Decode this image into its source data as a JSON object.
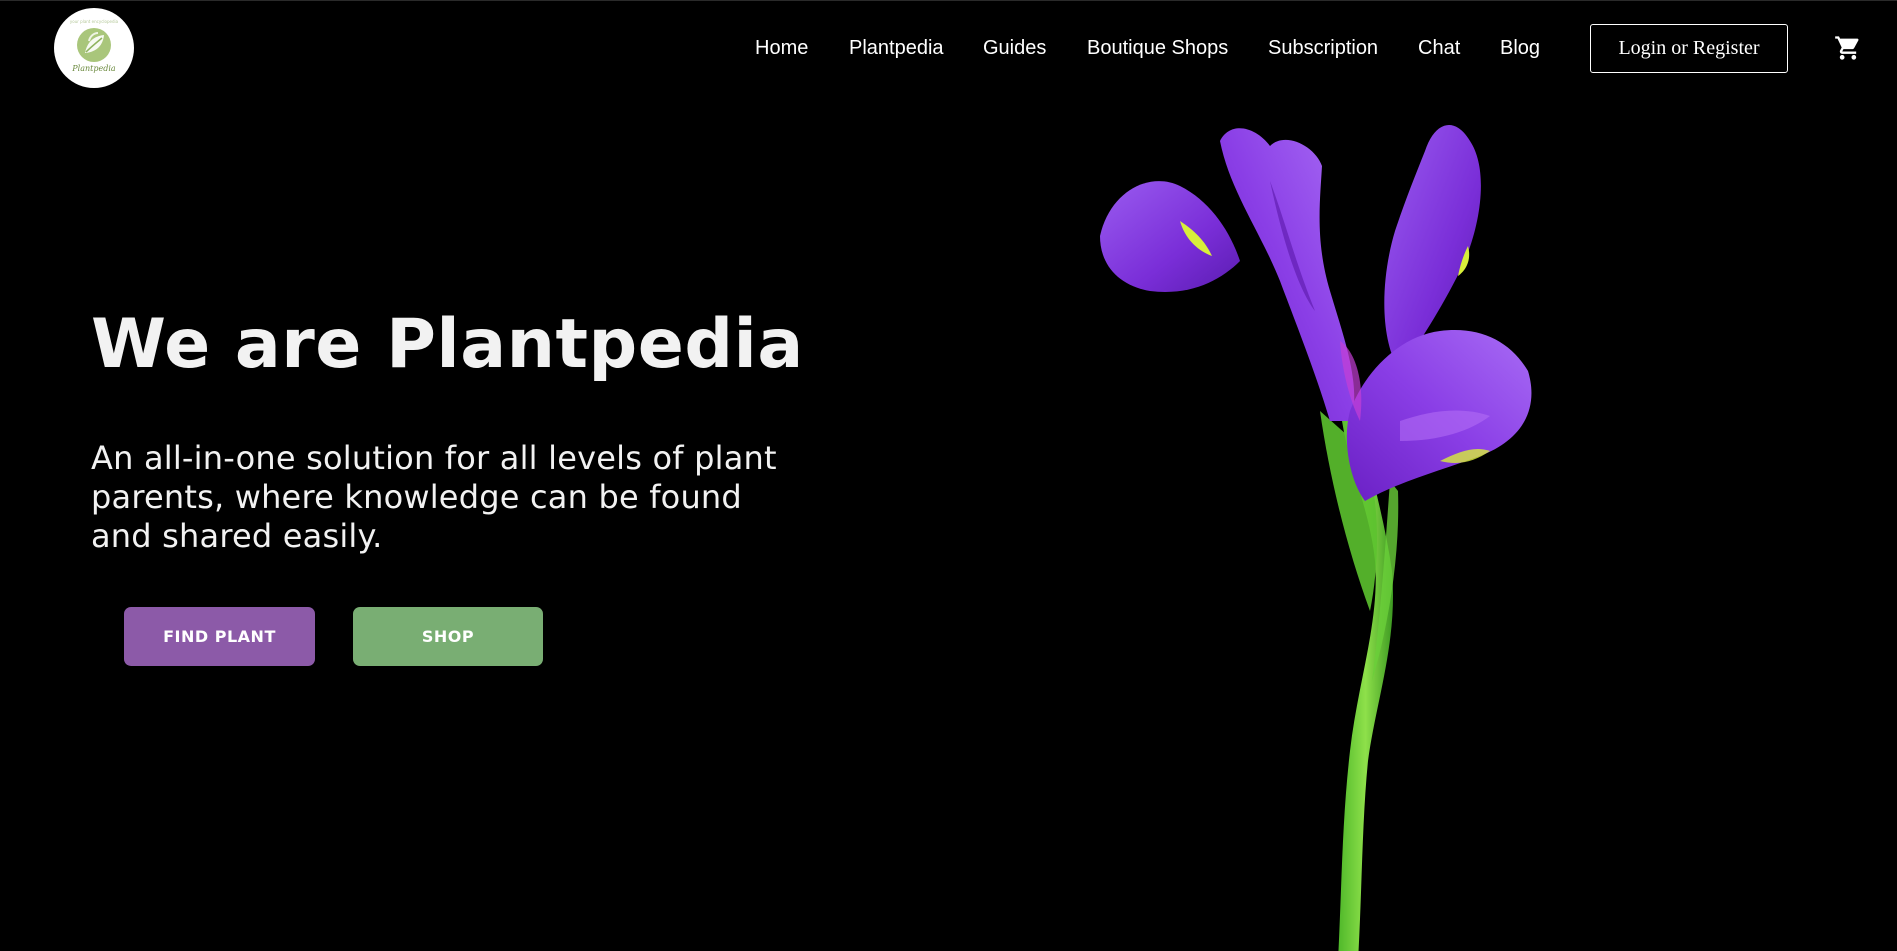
{
  "logo": {
    "text": "Plantpedia",
    "tagline": "your plant encyclopedia"
  },
  "nav": {
    "items": [
      {
        "label": "Home",
        "id": "home"
      },
      {
        "label": "Plantpedia",
        "id": "plantpedia"
      },
      {
        "label": "Guides",
        "id": "guides"
      },
      {
        "label": "Boutique Shops",
        "id": "boutique-shops"
      },
      {
        "label": "Subscription",
        "id": "subscription"
      },
      {
        "label": "Chat",
        "id": "chat"
      },
      {
        "label": "Blog",
        "id": "blog"
      }
    ],
    "login_label": "Login or Register",
    "cart_icon": "shopping-cart-icon"
  },
  "hero": {
    "title": "We are Plantpedia",
    "subtitle": "An all-in-one solution for all levels of plant parents, where knowledge can be found and shared easily.",
    "find_label": "FIND PLANT",
    "shop_label": "SHOP",
    "image": "purple-iris-flower"
  },
  "colors": {
    "background": "#000000",
    "find_button": "#8c5aa8",
    "shop_button": "#79ae73",
    "text": "#f2f2f2",
    "logo_green": "#8fb35e"
  }
}
